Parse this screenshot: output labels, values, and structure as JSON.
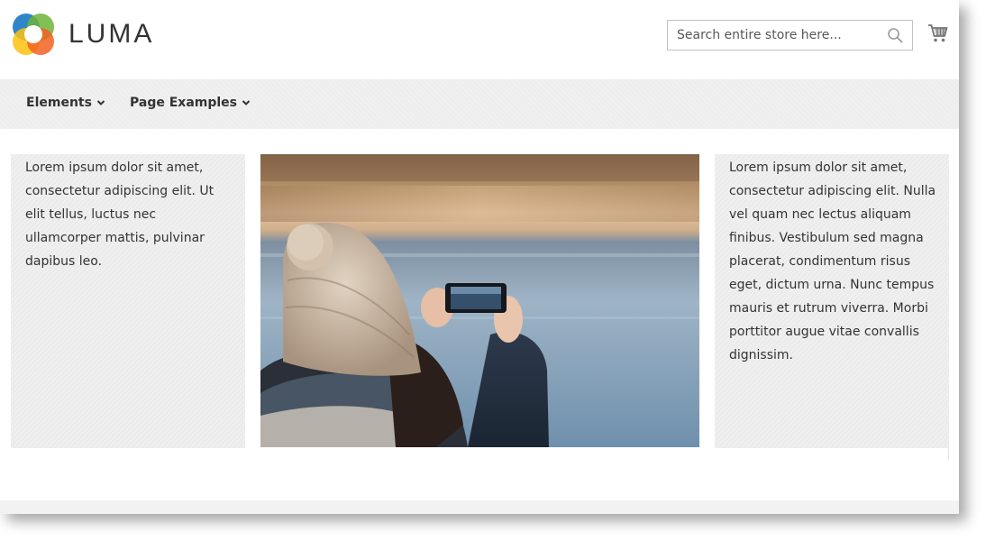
{
  "header": {
    "logo_text": "LUMA",
    "search": {
      "placeholder": "Search entire store here...",
      "value": ""
    },
    "icons": [
      "logo-mark",
      "search-icon",
      "shopping-cart-icon"
    ]
  },
  "nav": {
    "items": [
      {
        "label": "Elements",
        "icon": "chevron-down-icon"
      },
      {
        "label": "Page Examples",
        "icon": "chevron-down-icon"
      }
    ]
  },
  "content": {
    "left_text": "Lorem ipsum dolor sit amet, consectetur adipiscing elit. Ut elit tellus, luctus nec ullamcorper mattis, pulvinar dapibus leo.",
    "right_text": "Lorem ipsum dolor sit amet, consectetur adipiscing elit. Nulla vel quam nec lectus aliquam finibus. Vestibulum sed magna placerat, condimentum risus eget, dictum urna. Nunc tempus mauris et rutrum viverra. Morbi porttitor augue vitae convallis dignissim."
  },
  "colors": {
    "text": "#333333",
    "nav_bg": "#f0f0f0",
    "panel_bg": "#efefef",
    "logo_orange": "#f26322",
    "logo_blue": "#1979c3",
    "logo_green": "#6fb33a",
    "logo_yellow": "#ffc20e"
  }
}
